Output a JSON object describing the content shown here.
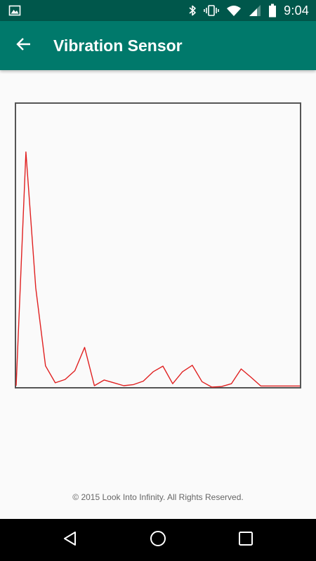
{
  "status_bar": {
    "time": "9:04",
    "icons": [
      "image-notification-icon",
      "bluetooth-icon",
      "vibrate-icon",
      "wifi-icon",
      "cell-signal-icon",
      "battery-icon"
    ]
  },
  "app_bar": {
    "title": "Vibration Sensor",
    "back_icon": "arrow-back-icon"
  },
  "colors": {
    "status_bar": "#00574b",
    "app_bar": "#00796b",
    "plot_line": "#e02020",
    "plot_border": "#555555",
    "background": "#fafafa",
    "nav_bar": "#000000"
  },
  "chart_data": {
    "type": "line",
    "title": "",
    "xlabel": "",
    "ylabel": "",
    "grid": false,
    "xlim": [
      0,
      29
    ],
    "ylim": [
      0,
      100
    ],
    "series": [
      {
        "x": [
          0,
          1,
          2,
          3,
          4,
          5,
          6,
          7,
          8,
          9,
          10,
          11,
          12,
          13,
          14,
          15,
          16,
          17,
          18,
          19,
          20,
          21,
          22,
          23,
          24,
          25,
          26,
          27,
          28,
          29
        ],
        "values": [
          0.5,
          83,
          35,
          7.5,
          1.5,
          2.7,
          5.8,
          14,
          0.5,
          2.5,
          1.5,
          0.5,
          0.9,
          2.1,
          5.4,
          7.4,
          1.2,
          5.4,
          7.7,
          1.9,
          0,
          0.2,
          1.2,
          6.4,
          3.5,
          0.4,
          0.4,
          0.4,
          0.4,
          0.4
        ]
      }
    ]
  },
  "footer": {
    "copyright": "© 2015 Look Into Infinity. All Rights Reserved."
  },
  "nav_bar": {
    "back_icon": "nav-back-icon",
    "home_icon": "nav-home-icon",
    "recent_icon": "nav-recent-apps-icon"
  }
}
